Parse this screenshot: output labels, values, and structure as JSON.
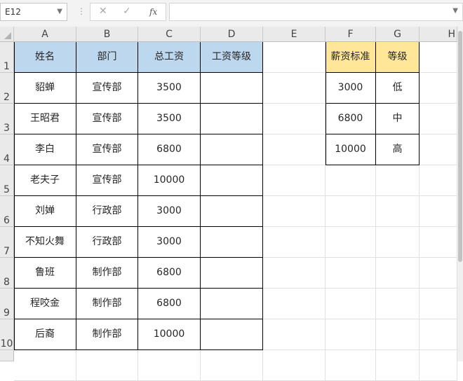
{
  "formula_bar": {
    "name_box": "E12",
    "cancel_icon": "✕",
    "enter_icon": "✓",
    "fx_label": "fx",
    "formula_value": ""
  },
  "columns": [
    "A",
    "B",
    "C",
    "D",
    "E",
    "F",
    "G",
    "H"
  ],
  "rows": [
    "1",
    "2",
    "3",
    "4",
    "5",
    "6",
    "7",
    "8",
    "9",
    "10"
  ],
  "table1": {
    "headers": [
      "姓名",
      "部门",
      "总工资",
      "工资等级"
    ],
    "rows": [
      [
        "貂蝉",
        "宣传部",
        "3500",
        ""
      ],
      [
        "王昭君",
        "宣传部",
        "3500",
        ""
      ],
      [
        "李白",
        "宣传部",
        "6800",
        ""
      ],
      [
        "老夫子",
        "宣传部",
        "10000",
        ""
      ],
      [
        "刘婵",
        "行政部",
        "3000",
        ""
      ],
      [
        "不知火舞",
        "行政部",
        "3000",
        ""
      ],
      [
        "鲁班",
        "制作部",
        "6800",
        ""
      ],
      [
        "程咬金",
        "制作部",
        "6800",
        ""
      ],
      [
        "后裔",
        "制作部",
        "10000",
        ""
      ]
    ],
    "header_color": "#bdd7ee"
  },
  "table2": {
    "headers": [
      "薪资标准",
      "等级"
    ],
    "rows": [
      [
        "3000",
        "低"
      ],
      [
        "6800",
        "中"
      ],
      [
        "10000",
        "高"
      ]
    ],
    "header_color": "#ffe699"
  }
}
